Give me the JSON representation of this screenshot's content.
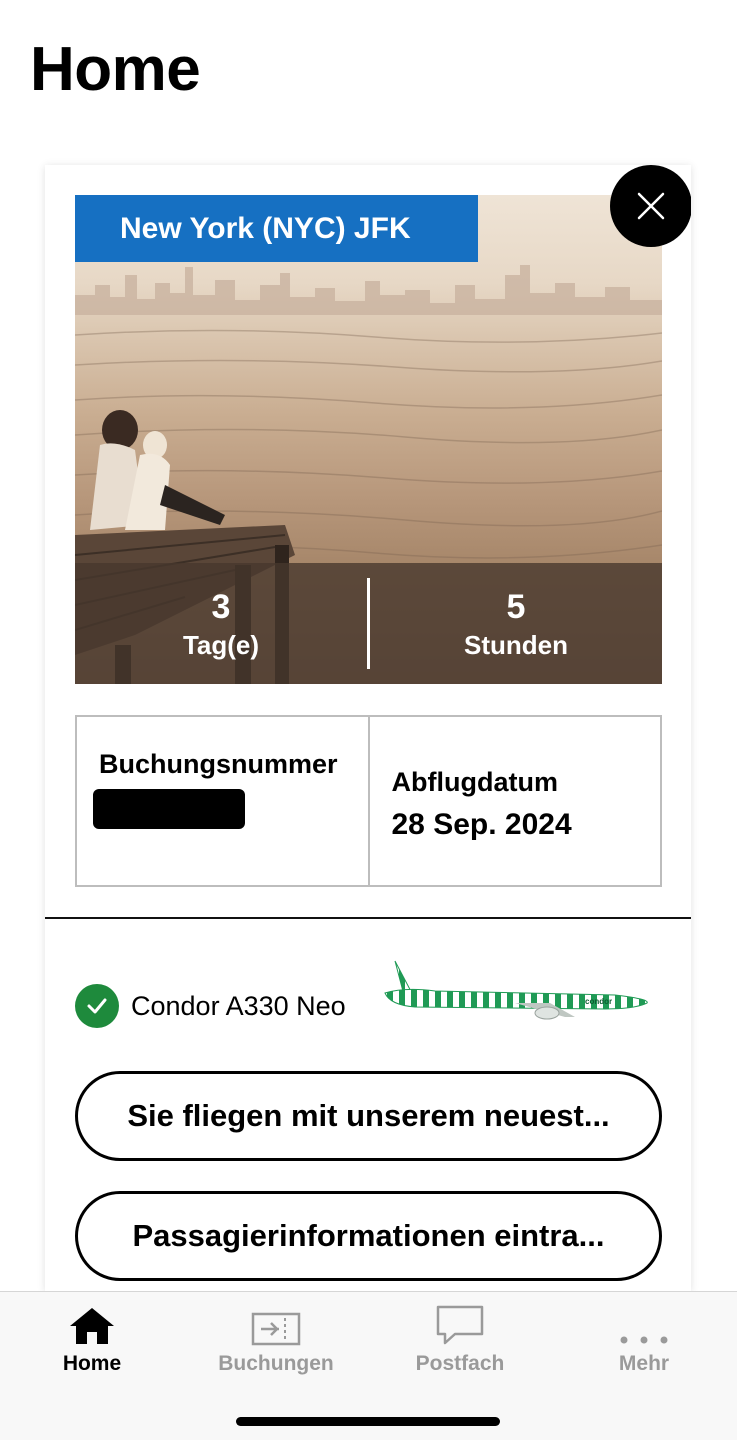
{
  "page": {
    "title": "Home"
  },
  "trip_card": {
    "destination": "New York (NYC) JFK",
    "countdown": {
      "days_value": "3",
      "days_label": "Tag(e)",
      "hours_value": "5",
      "hours_label": "Stunden"
    },
    "booking": {
      "label": "Buchungsnummer",
      "value_redacted": true
    },
    "departure": {
      "label": "Abflugdatum",
      "value": "28 Sep. 2024"
    },
    "aircraft": {
      "name": "Condor A330 Neo",
      "status_icon": "check-icon",
      "livery_text": "condor"
    },
    "buttons": {
      "newest_aircraft": "Sie fliegen mit unserem neuest...",
      "passenger_info": "Passagierinformationen eintra..."
    }
  },
  "tabbar": {
    "items": [
      {
        "label": "Home",
        "icon": "home-icon",
        "active": true
      },
      {
        "label": "Buchungen",
        "icon": "ticket-icon",
        "active": false
      },
      {
        "label": "Postfach",
        "icon": "message-icon",
        "active": false
      },
      {
        "label": "Mehr",
        "icon": "more-icon",
        "active": false
      }
    ]
  },
  "colors": {
    "accent_blue": "#1670c2",
    "success_green": "#1e8a3c",
    "livery_green": "#1f9a55"
  }
}
